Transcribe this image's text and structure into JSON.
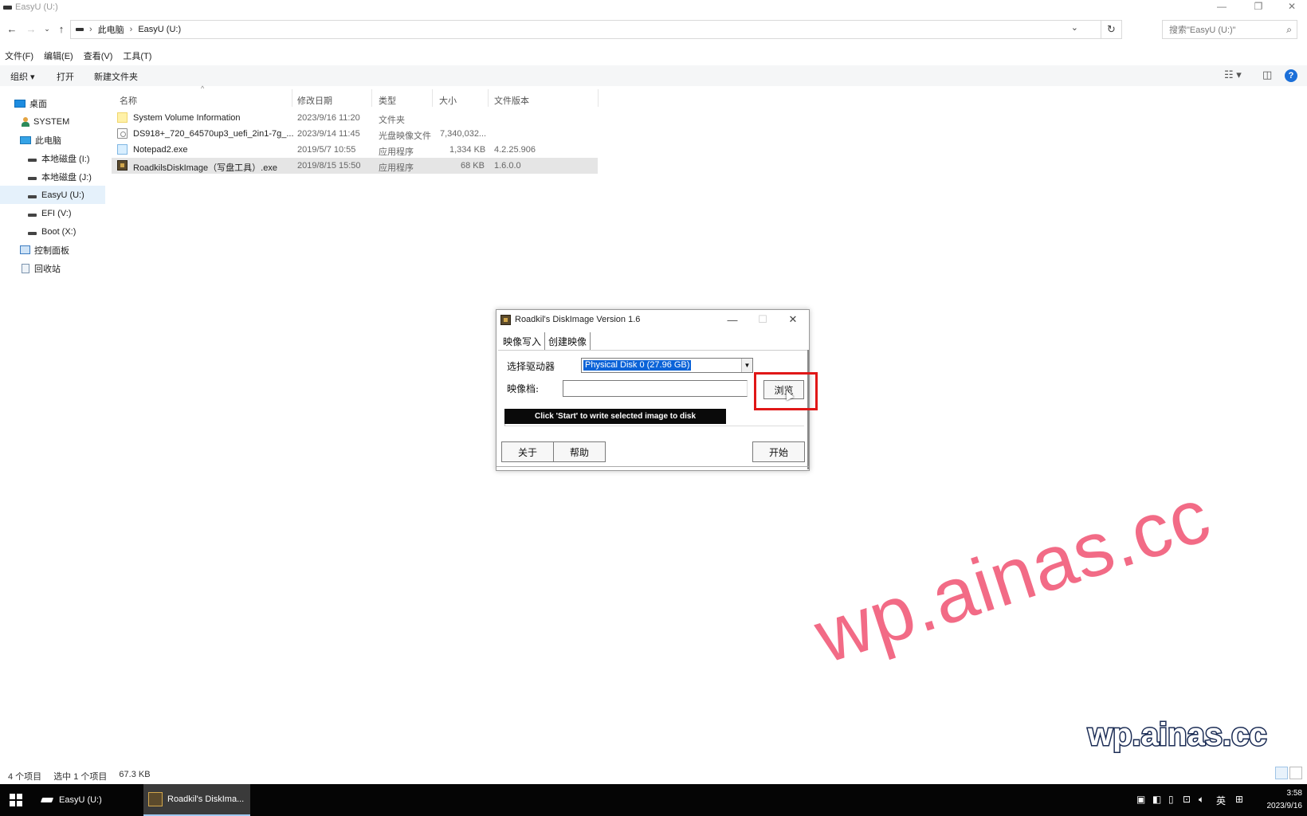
{
  "window": {
    "title": "EasyU (U:)"
  },
  "address": {
    "crumbs": [
      "此电脑",
      "EasyU (U:)"
    ],
    "search_placeholder": "搜索\"EasyU (U:)\""
  },
  "menu": [
    "文件(F)",
    "编辑(E)",
    "查看(V)",
    "工具(T)"
  ],
  "commands": {
    "organize": "组织 ▾",
    "open": "打开",
    "new_folder": "新建文件夹"
  },
  "sidebar": {
    "items": [
      {
        "label": "桌面",
        "icon": "desktop-icon"
      },
      {
        "label": "SYSTEM",
        "icon": "user-icon"
      },
      {
        "label": "此电脑",
        "icon": "pc-icon"
      },
      {
        "label": "本地磁盘 (I:)",
        "icon": "drive-icon"
      },
      {
        "label": "本地磁盘 (J:)",
        "icon": "drive-icon"
      },
      {
        "label": "EasyU (U:)",
        "icon": "drive-icon"
      },
      {
        "label": "EFI (V:)",
        "icon": "drive-icon"
      },
      {
        "label": "Boot (X:)",
        "icon": "drive-icon"
      },
      {
        "label": "控制面板",
        "icon": "control-panel-icon"
      },
      {
        "label": "回收站",
        "icon": "recycle-bin-icon"
      }
    ]
  },
  "files": {
    "columns": [
      "名称",
      "修改日期",
      "类型",
      "大小",
      "文件版本"
    ],
    "rows": [
      {
        "name": "System Volume Information",
        "date": "2023/9/16 11:20",
        "type": "文件夹",
        "size": "",
        "version": "",
        "icon": "folder-icon"
      },
      {
        "name": "DS918+_720_64570up3_uefi_2in1-7g_...",
        "date": "2023/9/14 11:45",
        "type": "光盘映像文件",
        "size": "7,340,032...",
        "version": "",
        "icon": "iso-icon"
      },
      {
        "name": "Notepad2.exe",
        "date": "2019/5/7 10:55",
        "type": "应用程序",
        "size": "1,334 KB",
        "version": "4.2.25.906",
        "icon": "app-icon"
      },
      {
        "name": "RoadkilsDiskImage（写盘工具）.exe",
        "date": "2019/8/15 15:50",
        "type": "应用程序",
        "size": "68 KB",
        "version": "1.6.0.0",
        "icon": "diskimage-icon"
      }
    ]
  },
  "status": {
    "count": "4 个项目",
    "selected": "选中 1 个项目",
    "size": "67.3 KB"
  },
  "dialog": {
    "title": "Roadkil's DiskImage Version 1.6",
    "tabs": [
      "映像写入",
      "创建映像"
    ],
    "drive_label": "选择驱动器",
    "drive_value": "Physical Disk 0 (27.96 GB)",
    "image_label": "映像档:",
    "image_value": "",
    "browse": "浏览",
    "progress_text": "Click 'Start' to write selected image to disk",
    "about": "关于",
    "help": "帮助",
    "start": "开始"
  },
  "watermark": {
    "big": "wp.ainas.cc",
    "small": "wp.ainas.cc"
  },
  "taskbar": {
    "items": [
      "EasyU (U:)",
      "Roadkil's DiskIma..."
    ],
    "ime": "英",
    "time": "3:58",
    "date": "2023/9/16"
  }
}
